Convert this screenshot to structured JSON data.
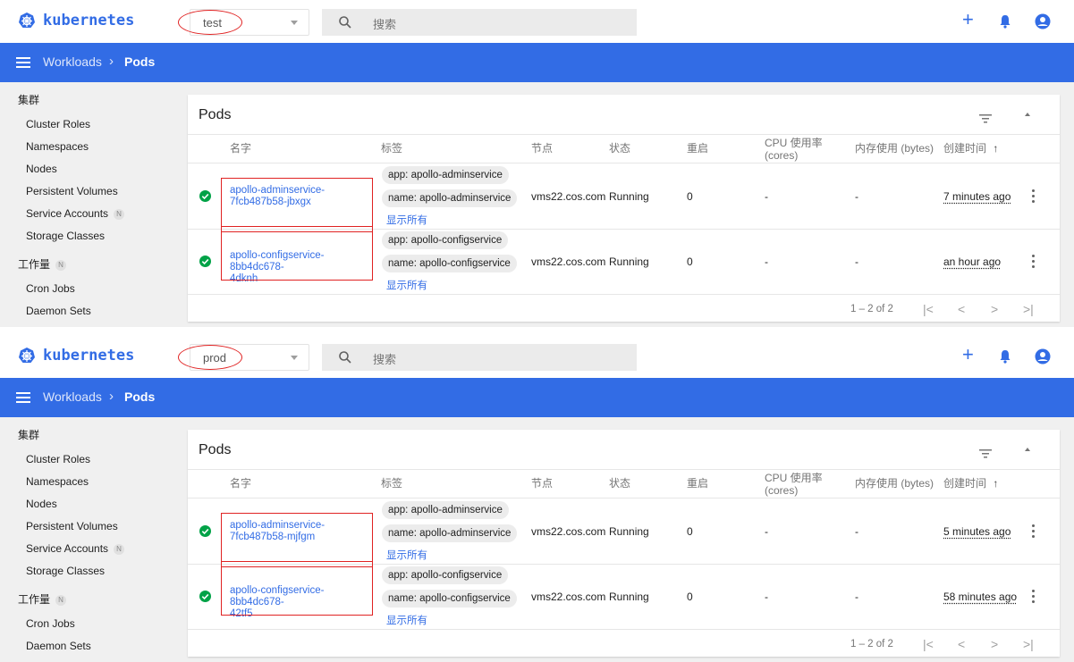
{
  "app": {
    "name": "kubernetes",
    "search_placeholder": "搜索"
  },
  "breadcrumb": {
    "parent": "Workloads",
    "separator": "›",
    "current": "Pods"
  },
  "sidebar": {
    "cluster_header": "集群",
    "cluster_items": [
      "Cluster Roles",
      "Namespaces",
      "Nodes",
      "Persistent Volumes",
      "Service Accounts",
      "Storage Classes"
    ],
    "workloads_header": "工作量",
    "workload_items": [
      "Cron Jobs",
      "Daemon Sets"
    ],
    "badge": "N"
  },
  "card": {
    "title": "Pods",
    "columns": {
      "name": "名字",
      "labels": "标签",
      "node": "节点",
      "status": "状态",
      "restarts": "重启",
      "cpu_line1": "CPU 使用率",
      "cpu_line2": "(cores)",
      "memory": "内存使用 (bytes)",
      "created": "创建时间",
      "sort_arrow": "↑"
    },
    "show_all": "显示所有",
    "pager": {
      "range": "1 – 2 of 2",
      "first": "|<",
      "prev": "<",
      "next": ">",
      "last": ">|"
    }
  },
  "panels": [
    {
      "namespace": "test",
      "rows": [
        {
          "name_line1": "apollo-adminservice-",
          "name_line2": "7fcb487b58-jbxgx",
          "label_app": "app: apollo-adminservice",
          "label_name": "name: apollo-adminservice",
          "node": "vms22.cos.com",
          "status": "Running",
          "restarts": "0",
          "cpu": "-",
          "memory": "-",
          "created": "7 minutes ago"
        },
        {
          "name_line1": "apollo-configservice-8bb4dc678-",
          "name_line2": "4dknh",
          "label_app": "app: apollo-configservice",
          "label_name": "name: apollo-configservice",
          "node": "vms22.cos.com",
          "status": "Running",
          "restarts": "0",
          "cpu": "-",
          "memory": "-",
          "created": "an hour ago"
        }
      ]
    },
    {
      "namespace": "prod",
      "rows": [
        {
          "name_line1": "apollo-adminservice-",
          "name_line2": "7fcb487b58-mjfgm",
          "label_app": "app: apollo-adminservice",
          "label_name": "name: apollo-adminservice",
          "node": "vms22.cos.com",
          "status": "Running",
          "restarts": "0",
          "cpu": "-",
          "memory": "-",
          "created": "5 minutes ago"
        },
        {
          "name_line1": "apollo-configservice-8bb4dc678-",
          "name_line2": "42tf5",
          "label_app": "app: apollo-configservice",
          "label_name": "name: apollo-configservice",
          "node": "vms22.cos.com",
          "status": "Running",
          "restarts": "0",
          "cpu": "-",
          "memory": "-",
          "created": "58 minutes ago"
        }
      ]
    }
  ],
  "colors": {
    "primary": "#326ce5",
    "success": "#00a247",
    "annotation": "#e02222"
  }
}
